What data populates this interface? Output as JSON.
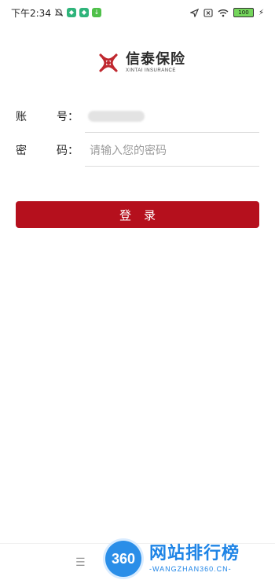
{
  "status_bar": {
    "time": "下午2:34",
    "battery": "100"
  },
  "logo": {
    "name_cn": "信泰保险",
    "name_en": "XINTAI INSURANCE"
  },
  "form": {
    "account_label_1": "账",
    "account_label_2": "号：",
    "account_value": "",
    "password_label_1": "密",
    "password_label_2": "码：",
    "password_placeholder": "请输入您的密码",
    "login_button": "登录"
  },
  "nav": {
    "menu_glyph": "☰"
  },
  "watermark": {
    "badge": "360",
    "text_cn": "网站排行榜",
    "text_en": "-WANGZHAN360.CN-"
  },
  "colors": {
    "primary": "#b5101d",
    "watermark": "#1e84e6"
  }
}
